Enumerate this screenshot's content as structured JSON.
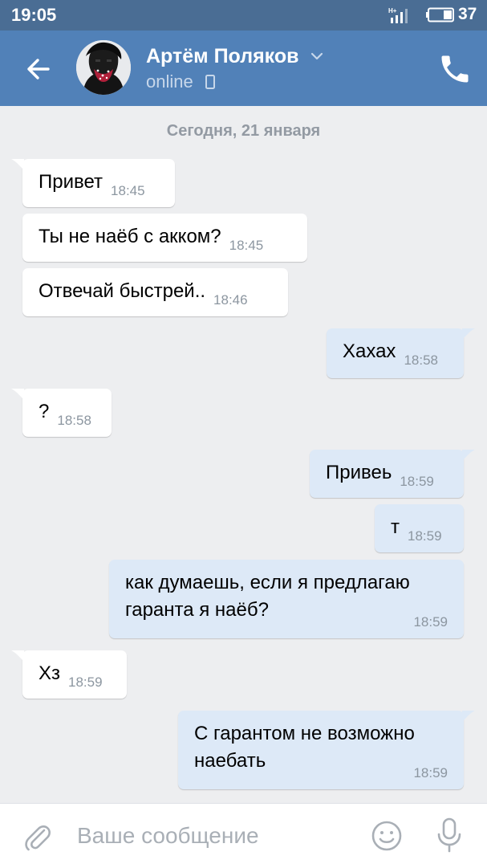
{
  "status_bar": {
    "time": "19:05",
    "battery": "37",
    "signal_icon": "signal-icon",
    "battery_icon": "battery-icon"
  },
  "header": {
    "name": "Артём Поляков",
    "status": "online",
    "back_icon": "arrow-left-icon",
    "call_icon": "phone-icon",
    "accent_color": "#5181b8"
  },
  "chat": {
    "date_separator": "Сегодня, 21 января",
    "messages": [
      {
        "direction": "in",
        "lines": [
          "Привет"
        ],
        "time": "18:45"
      },
      {
        "direction": "in",
        "lines": [
          "Ты не наёб с акком?"
        ],
        "time": "18:45"
      },
      {
        "direction": "in",
        "lines": [
          "Отвечай быстрей.."
        ],
        "time": "18:46"
      },
      {
        "direction": "out",
        "lines": [
          "Хахах"
        ],
        "time": "18:58"
      },
      {
        "direction": "in",
        "lines": [
          "?"
        ],
        "time": "18:58"
      },
      {
        "direction": "out",
        "lines": [
          "Привеь"
        ],
        "time": "18:59"
      },
      {
        "direction": "out",
        "lines": [
          "т"
        ],
        "time": "18:59"
      },
      {
        "direction": "out",
        "lines": [
          "как думаешь, если я предлагаю",
          "гаранта я наёб?"
        ],
        "time": "18:59"
      },
      {
        "direction": "in",
        "lines": [
          "Хз"
        ],
        "time": "18:59"
      },
      {
        "direction": "out",
        "lines": [
          "С гарантом не возможно",
          "наебать"
        ],
        "time": "18:59"
      }
    ],
    "incoming_bubble_color": "#ffffff",
    "outgoing_bubble_color": "#dde9f7"
  },
  "input_bar": {
    "placeholder": "Ваше сообщение",
    "attach_icon": "paperclip-icon",
    "emoji_icon": "smile-icon",
    "mic_icon": "microphone-icon"
  }
}
